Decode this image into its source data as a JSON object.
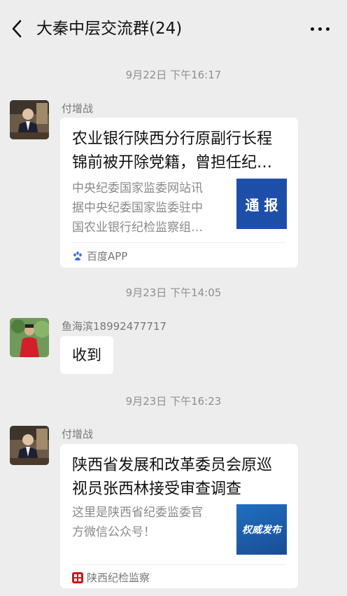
{
  "header": {
    "title": "大秦中层交流群(24)"
  },
  "messages": [
    {
      "timestamp": "9月22日 下午16:17",
      "sender": "付增战",
      "type": "link",
      "title_line1": "农业银行陕西分行原副行长程",
      "title_line2": "锦前被开除党籍，曾担任纪…",
      "desc_line1": "中央纪委国家监委网站讯",
      "desc_line2": "据中央纪委国家监委驻中",
      "desc_line3": "国农业银行纪检监察组…",
      "thumb_text": "通 报",
      "source": "百度APP"
    },
    {
      "timestamp": "9月23日 下午14:05",
      "sender": "鱼海滨18992477717",
      "type": "text",
      "text": "收到"
    },
    {
      "timestamp": "9月23日 下午16:23",
      "sender": "付增战",
      "type": "link",
      "title_line1": "陕西省发展和改革委员会原巡",
      "title_line2": "视员张西林接受审查调查",
      "desc_line1": "这里是陕西省纪委监委官",
      "desc_line2": "方微信公众号！",
      "thumb_text": "权威发布",
      "source": "陕西纪检监察"
    }
  ],
  "colors": {
    "background": "#ededed",
    "bubble": "#ffffff",
    "thumb_blue_1": "#1e4fa8",
    "thumb_blue_2": "#1f6fc0"
  }
}
